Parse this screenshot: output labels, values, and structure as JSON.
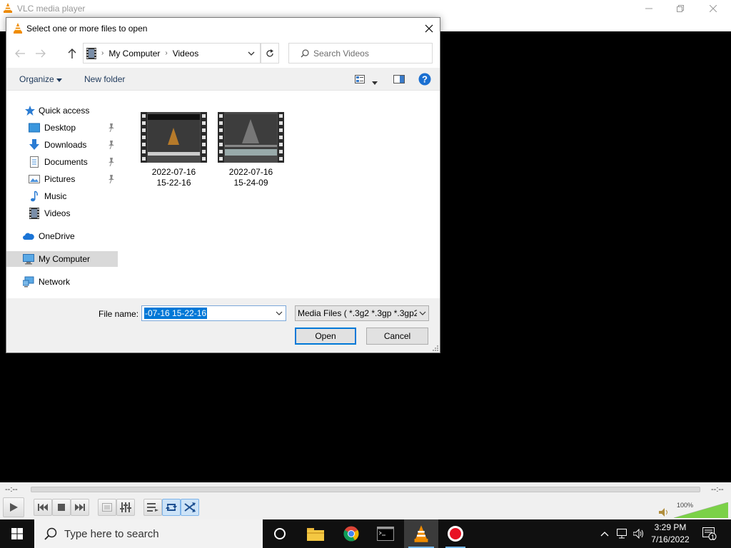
{
  "vlc": {
    "title": "VLC media player",
    "time_elapsed": "--:--",
    "time_remaining": "--:--",
    "volume_label": "100%",
    "volume_fraction": 1.0
  },
  "dialog": {
    "title": "Select one or more files to open",
    "address": {
      "segments": [
        "My Computer",
        "Videos"
      ]
    },
    "search_placeholder": "Search Videos",
    "commands": {
      "organize": "Organize",
      "new_folder": "New folder"
    },
    "nav": {
      "quick_access": "Quick access",
      "desktop": "Desktop",
      "downloads": "Downloads",
      "documents": "Documents",
      "pictures": "Pictures",
      "music": "Music",
      "videos": "Videos",
      "onedrive": "OneDrive",
      "my_computer": "My Computer",
      "network": "Network"
    },
    "files": [
      {
        "line1": "2022-07-16",
        "line2": "15-22-16"
      },
      {
        "line1": "2022-07-16",
        "line2": "15-24-09"
      }
    ],
    "file_name_label": "File name:",
    "file_name_value": "-07-16 15-22-16",
    "file_type": "Media Files ( *.3g2 *.3gp *.3gp2",
    "open_label": "Open",
    "cancel_label": "Cancel"
  },
  "taskbar": {
    "search_placeholder": "Type here to search",
    "time": "3:29 PM",
    "date": "7/16/2022",
    "notification_count": "1"
  },
  "colors": {
    "accent": "#0078d7",
    "vlc_orange": "#f08c00",
    "selection": "#d9d9d9"
  }
}
